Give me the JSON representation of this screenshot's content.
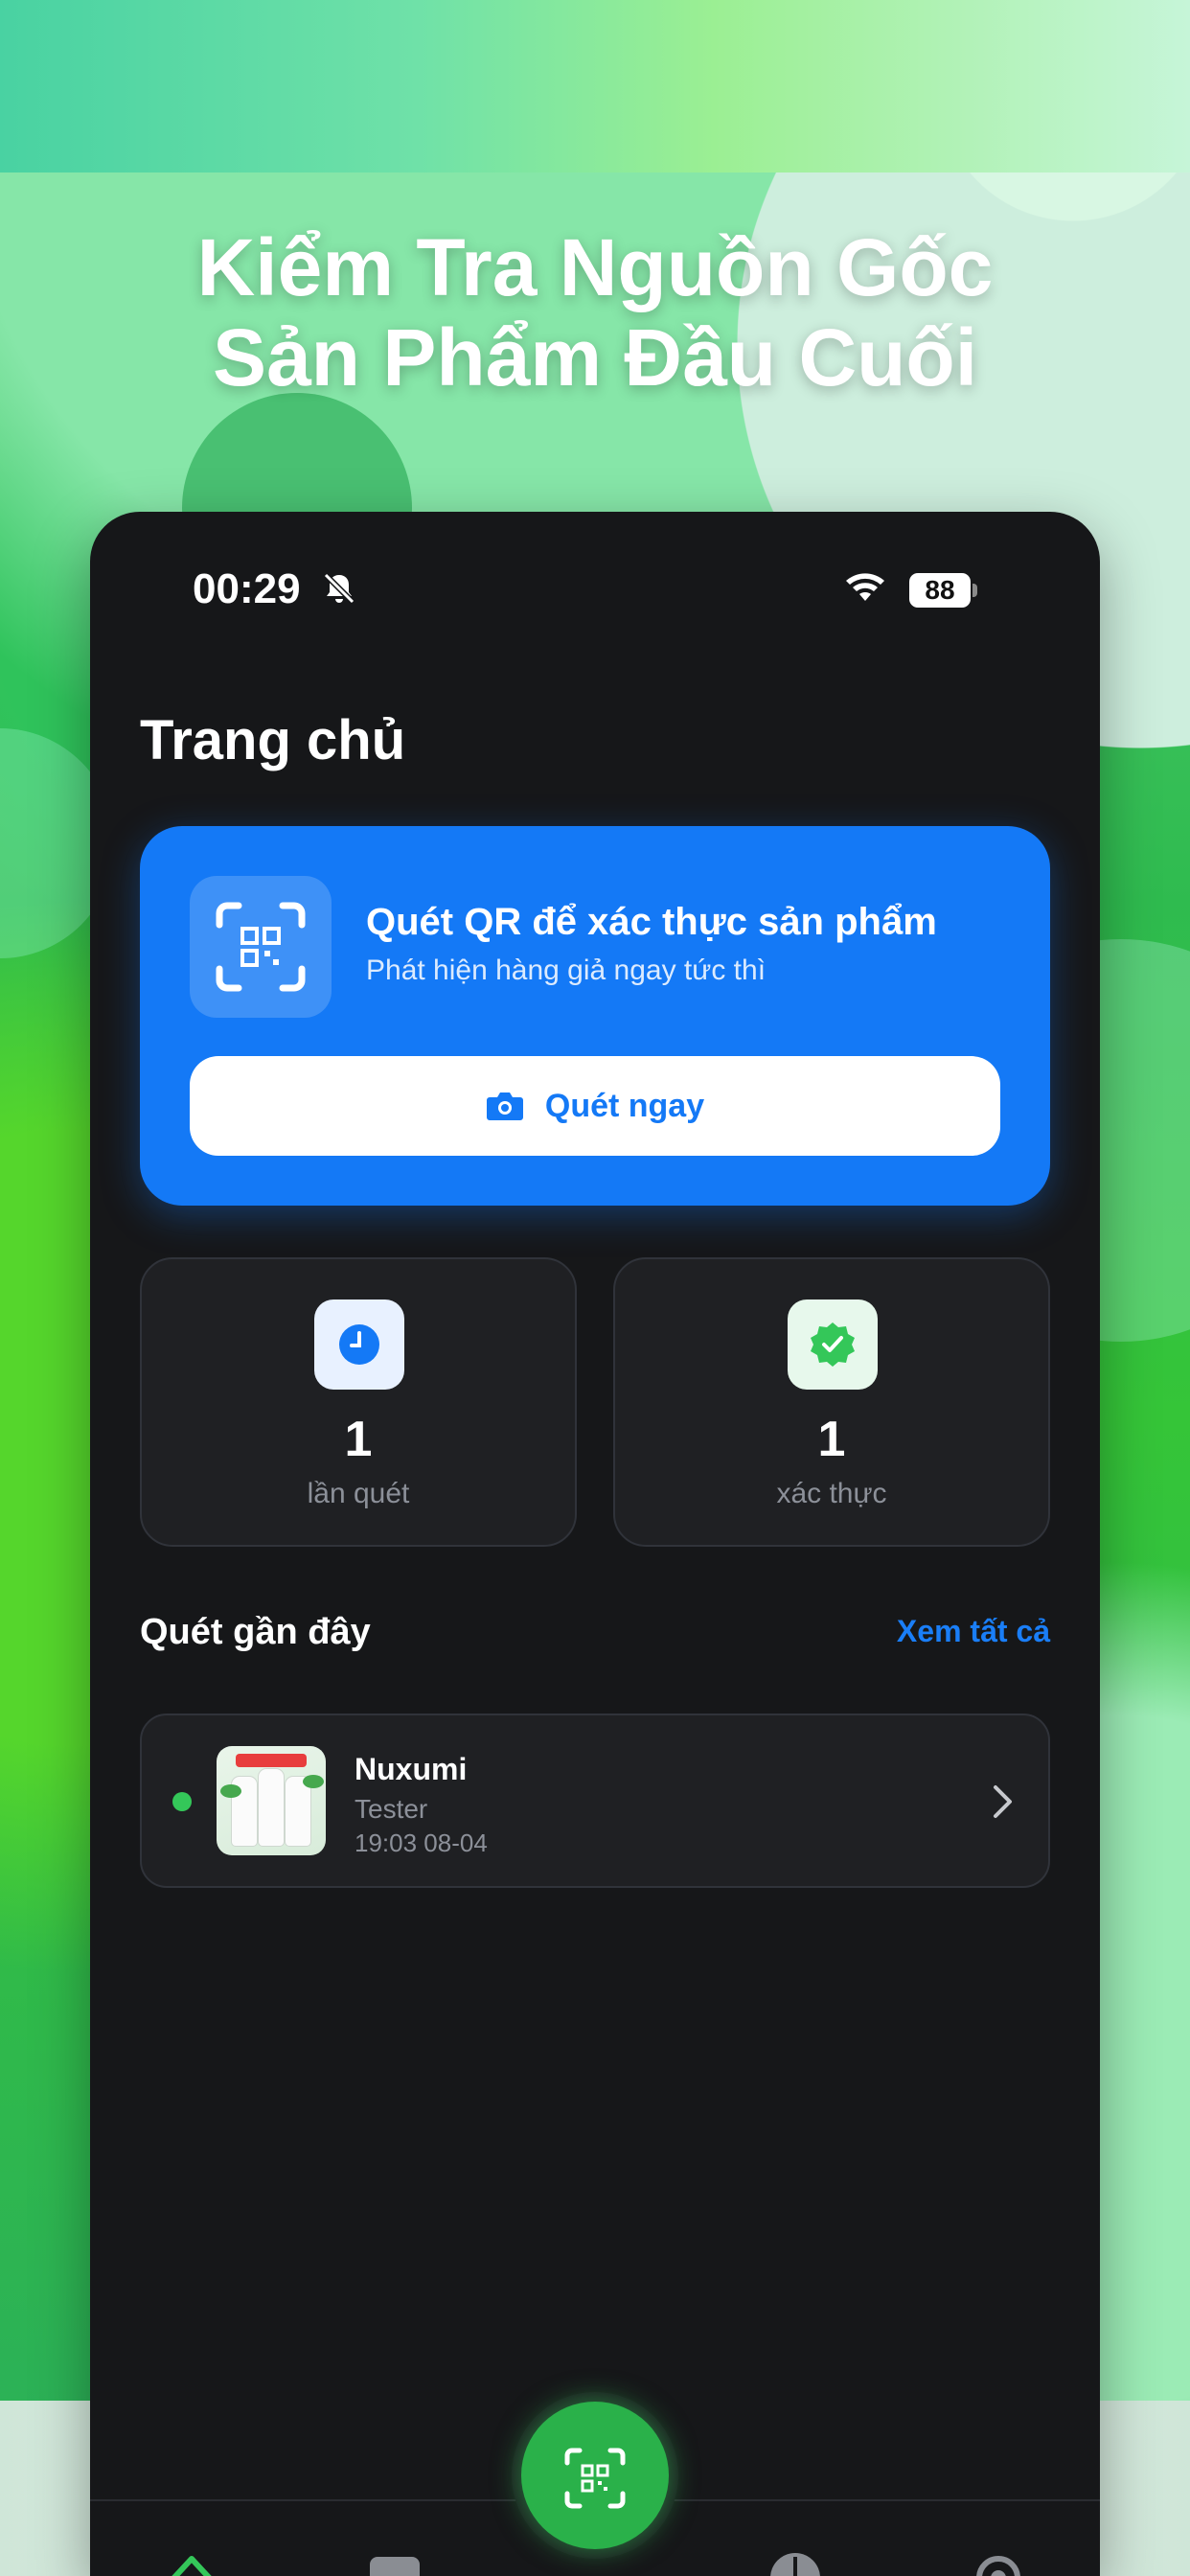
{
  "headline": {
    "line1": "Kiểm Tra Nguồn Gốc",
    "line2": "Sản Phẩm Đầu Cuối"
  },
  "status_bar": {
    "time": "00:29",
    "battery": "88",
    "icons": [
      "bell-slash-icon",
      "wifi-icon",
      "battery-icon"
    ]
  },
  "page": {
    "title": "Trang chủ"
  },
  "scan_card": {
    "title": "Quét QR để xác thực sản phẩm",
    "subtitle": "Phát hiện hàng giả ngay tức thì",
    "button_label": "Quét ngay",
    "icon": "qr-scan-icon",
    "button_icon": "camera-icon",
    "color": "#1479f6"
  },
  "stats": [
    {
      "value": "1",
      "label": "lần quét",
      "icon": "clock-icon",
      "icon_bg": "#e8f1ff",
      "icon_color": "#1479f6"
    },
    {
      "value": "1",
      "label": "xác thực",
      "icon": "verified-badge-icon",
      "icon_bg": "#e7f8ec",
      "icon_color": "#34c759"
    }
  ],
  "recent": {
    "title": "Quét gần đây",
    "see_all": "Xem tất cả",
    "items": [
      {
        "name": "Nuxumi",
        "brand": "Tester",
        "time": "19:03 08-04",
        "status_color": "#34c759"
      }
    ]
  },
  "tabbar": {
    "items": [
      "home-icon",
      "box-icon",
      "qr-scan-icon",
      "clock-icon",
      "gear-icon"
    ],
    "active": "home-icon",
    "accent": "#34c759"
  }
}
